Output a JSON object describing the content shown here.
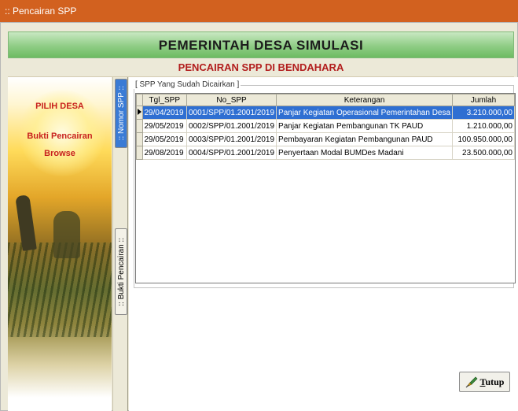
{
  "window": {
    "title": ":: Pencairan SPP"
  },
  "header": {
    "title": "PEMERINTAH DESA SIMULASI",
    "subtitle": "PENCAIRAN SPP DI BENDAHARA"
  },
  "sidebar": {
    "items": [
      {
        "label": "PILIH DESA"
      },
      {
        "label": "Bukti Pencairan"
      },
      {
        "label": "Browse"
      }
    ]
  },
  "tabs": [
    {
      "label": ":: Nomor SPP ::",
      "active": true
    },
    {
      "label": ":: Bukti Pencairan ::",
      "active": false
    }
  ],
  "group": {
    "legend": "[ SPP Yang Sudah Dicairkan ]"
  },
  "table": {
    "columns": [
      "Tgl_SPP",
      "No_SPP",
      "Keterangan",
      "Jumlah"
    ],
    "rows": [
      {
        "tgl": "29/04/2019",
        "no": "0001/SPP/01.2001/2019",
        "ket": "Panjar Kegiatan Operasional Pemerintahan Desa",
        "jumlah": "3.210.000,00",
        "selected": true
      },
      {
        "tgl": "29/05/2019",
        "no": "0002/SPP/01.2001/2019",
        "ket": "Panjar Kegiatan Pembangunan TK PAUD",
        "jumlah": "1.210.000,00",
        "selected": false
      },
      {
        "tgl": "29/05/2019",
        "no": "0003/SPP/01.2001/2019",
        "ket": "Pembayaran Kegiatan Pembangunan PAUD",
        "jumlah": "100.950.000,00",
        "selected": false
      },
      {
        "tgl": "29/08/2019",
        "no": "0004/SPP/01.2001/2019",
        "ket": "Penyertaan Modal BUMDes Madani",
        "jumlah": "23.500.000,00",
        "selected": false
      }
    ]
  },
  "buttons": {
    "close": {
      "label_key": "T",
      "label_rest": "utup",
      "icon": "brush-icon"
    }
  },
  "colors": {
    "titlebar": "#d2611f",
    "banner": "#8fcd85",
    "subtitle": "#b21d1d",
    "sidebar_link": "#c8211e",
    "selection": "#2f6fd2"
  }
}
